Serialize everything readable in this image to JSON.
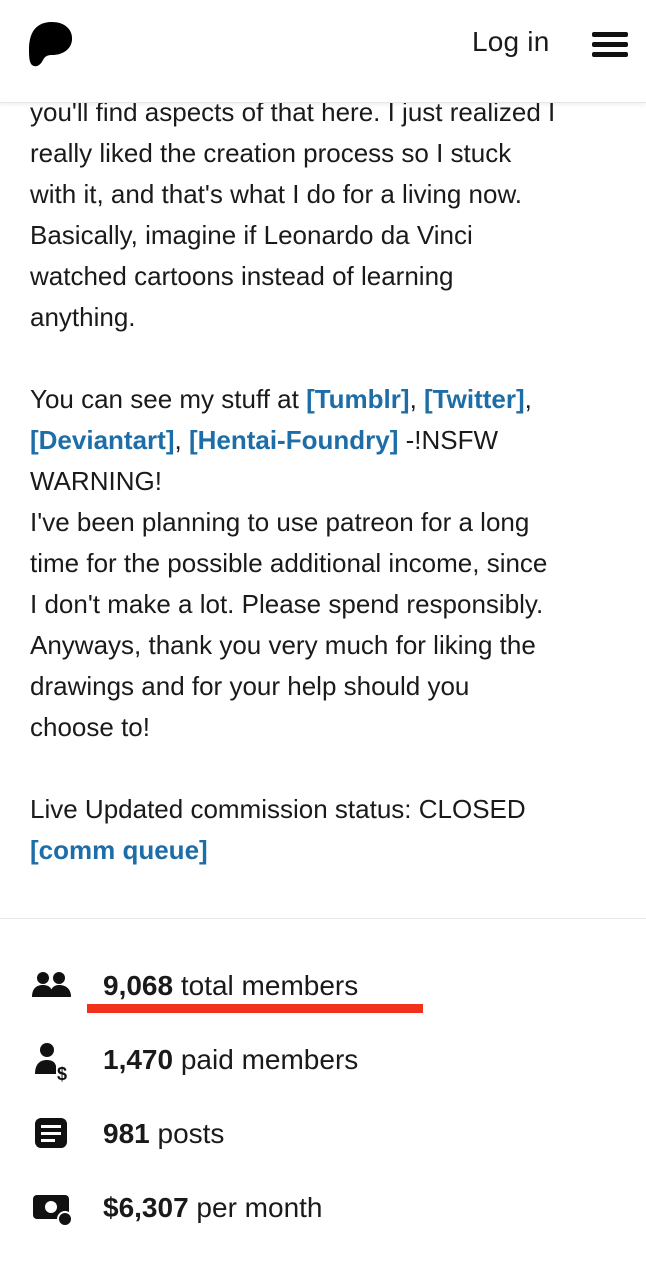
{
  "header": {
    "login_label": "Log in",
    "logo_icon": "patreon-logo-icon",
    "menu_icon": "hamburger-menu-icon"
  },
  "about": {
    "line1": "you'll find aspects of that here. I just realized I",
    "line2": "really liked the creation process so I stuck",
    "line3": "with it, and that's what I do for a living now.",
    "line4": "Basically, imagine if Leonardo da Vinci",
    "line5": "watched cartoons instead of learning",
    "line6": "anything.",
    "links_intro": "You can see my stuff at ",
    "link_tumblr": "[Tumblr]",
    "link_twitter": "[Twitter]",
    "link_deviantart": "[Deviantart]",
    "link_hentai": "[Hentai-Foundry]",
    "nsfw_a": " -!NSFW",
    "nsfw_b": "WARNING!",
    "p2_line1": "I've been planning to use patreon for a long",
    "p2_line2": "time for the possible additional income, since",
    "p2_line3": "I don't make a lot. Please spend responsibly.",
    "p2_line4": "Anyways, thank you very much for liking the",
    "p2_line5": "drawings and for your help should you",
    "p2_line6": "choose to!",
    "status_text": "Live Updated commission status: CLOSED",
    "link_queue": "[comm queue]"
  },
  "stats": [
    {
      "icon": "members-icon",
      "value": "9,068",
      "label": " total members"
    },
    {
      "icon": "paid-member-icon",
      "value": "1,470",
      "label": " paid members"
    },
    {
      "icon": "posts-icon",
      "value": "981",
      "label": " posts"
    },
    {
      "icon": "money-icon",
      "value": "$6,307",
      "label": " per month"
    }
  ],
  "colors": {
    "link": "#1d6ea8",
    "highlight_underline": "#f2311c"
  }
}
